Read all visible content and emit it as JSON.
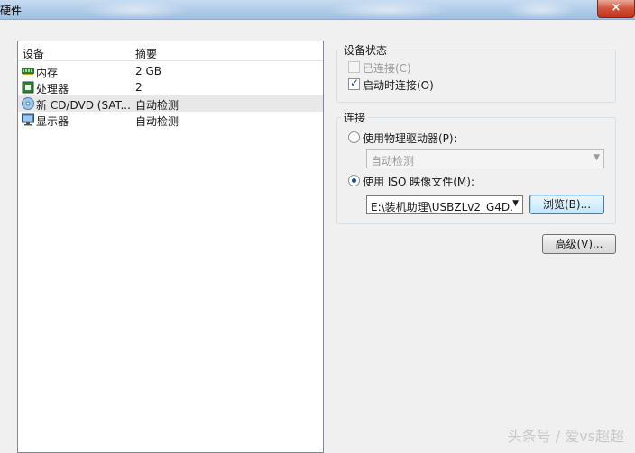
{
  "window": {
    "title": "硬件",
    "close_label": "×"
  },
  "device_list": {
    "headers": {
      "device": "设备",
      "summary": "摘要"
    },
    "rows": [
      {
        "icon": "memory-icon",
        "name": "内存",
        "summary": "2 GB",
        "selected": false
      },
      {
        "icon": "processor-icon",
        "name": "处理器",
        "summary": "2",
        "selected": false
      },
      {
        "icon": "cd-dvd-icon",
        "name": "新 CD/DVD (SAT...",
        "summary": "自动检测",
        "selected": true
      },
      {
        "icon": "display-icon",
        "name": "显示器",
        "summary": "自动检测",
        "selected": false
      }
    ]
  },
  "device_status": {
    "title": "设备状态",
    "connected_label": "已连接(C)",
    "connected_checked": false,
    "connected_enabled": false,
    "connect_at_power_on_label": "启动时连接(O)",
    "connect_at_power_on_checked": true
  },
  "connection": {
    "title": "连接",
    "physical_drive_label": "使用物理驱动器(P):",
    "physical_drive_selected": false,
    "physical_drive_value": "自动检测",
    "iso_label": "使用 ISO 映像文件(M):",
    "iso_selected": true,
    "iso_value": "E:\\装机助理\\USBZLv2_G4D.",
    "browse_label": "浏览(B)..."
  },
  "advanced_label": "高级(V)...",
  "watermark": "头条号 / 爱vs超超"
}
